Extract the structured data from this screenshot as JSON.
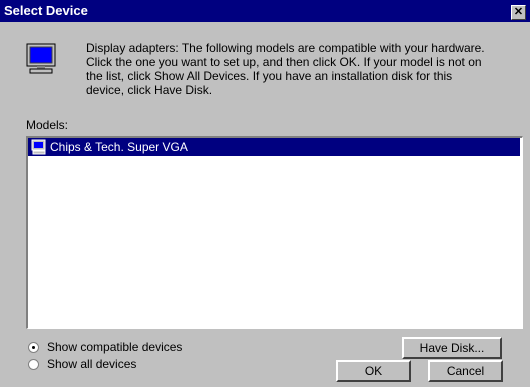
{
  "window": {
    "title": "Select Device",
    "close_glyph": "✕"
  },
  "description": "Display adapters: The following models are compatible with your hardware.\nClick the one you want to set up, and then click OK. If your model is not on\nthe list, click Show All Devices. If you have an installation disk for this\ndevice, click Have Disk.",
  "models": {
    "label": "Models:",
    "items": [
      {
        "label": "Chips & Tech. Super VGA",
        "selected": true,
        "icon": "display-adapter-icon"
      }
    ]
  },
  "options": {
    "show_compatible_label": "Show compatible devices",
    "show_all_label": "Show all devices",
    "selected": "show_compatible"
  },
  "buttons": {
    "have_disk": "Have Disk...",
    "ok": "OK",
    "cancel": "Cancel"
  },
  "icons": {
    "header_icon": "monitor-icon"
  },
  "colors": {
    "titlebar": "#000080",
    "face": "#c0c0c0",
    "selection": "#000080"
  }
}
